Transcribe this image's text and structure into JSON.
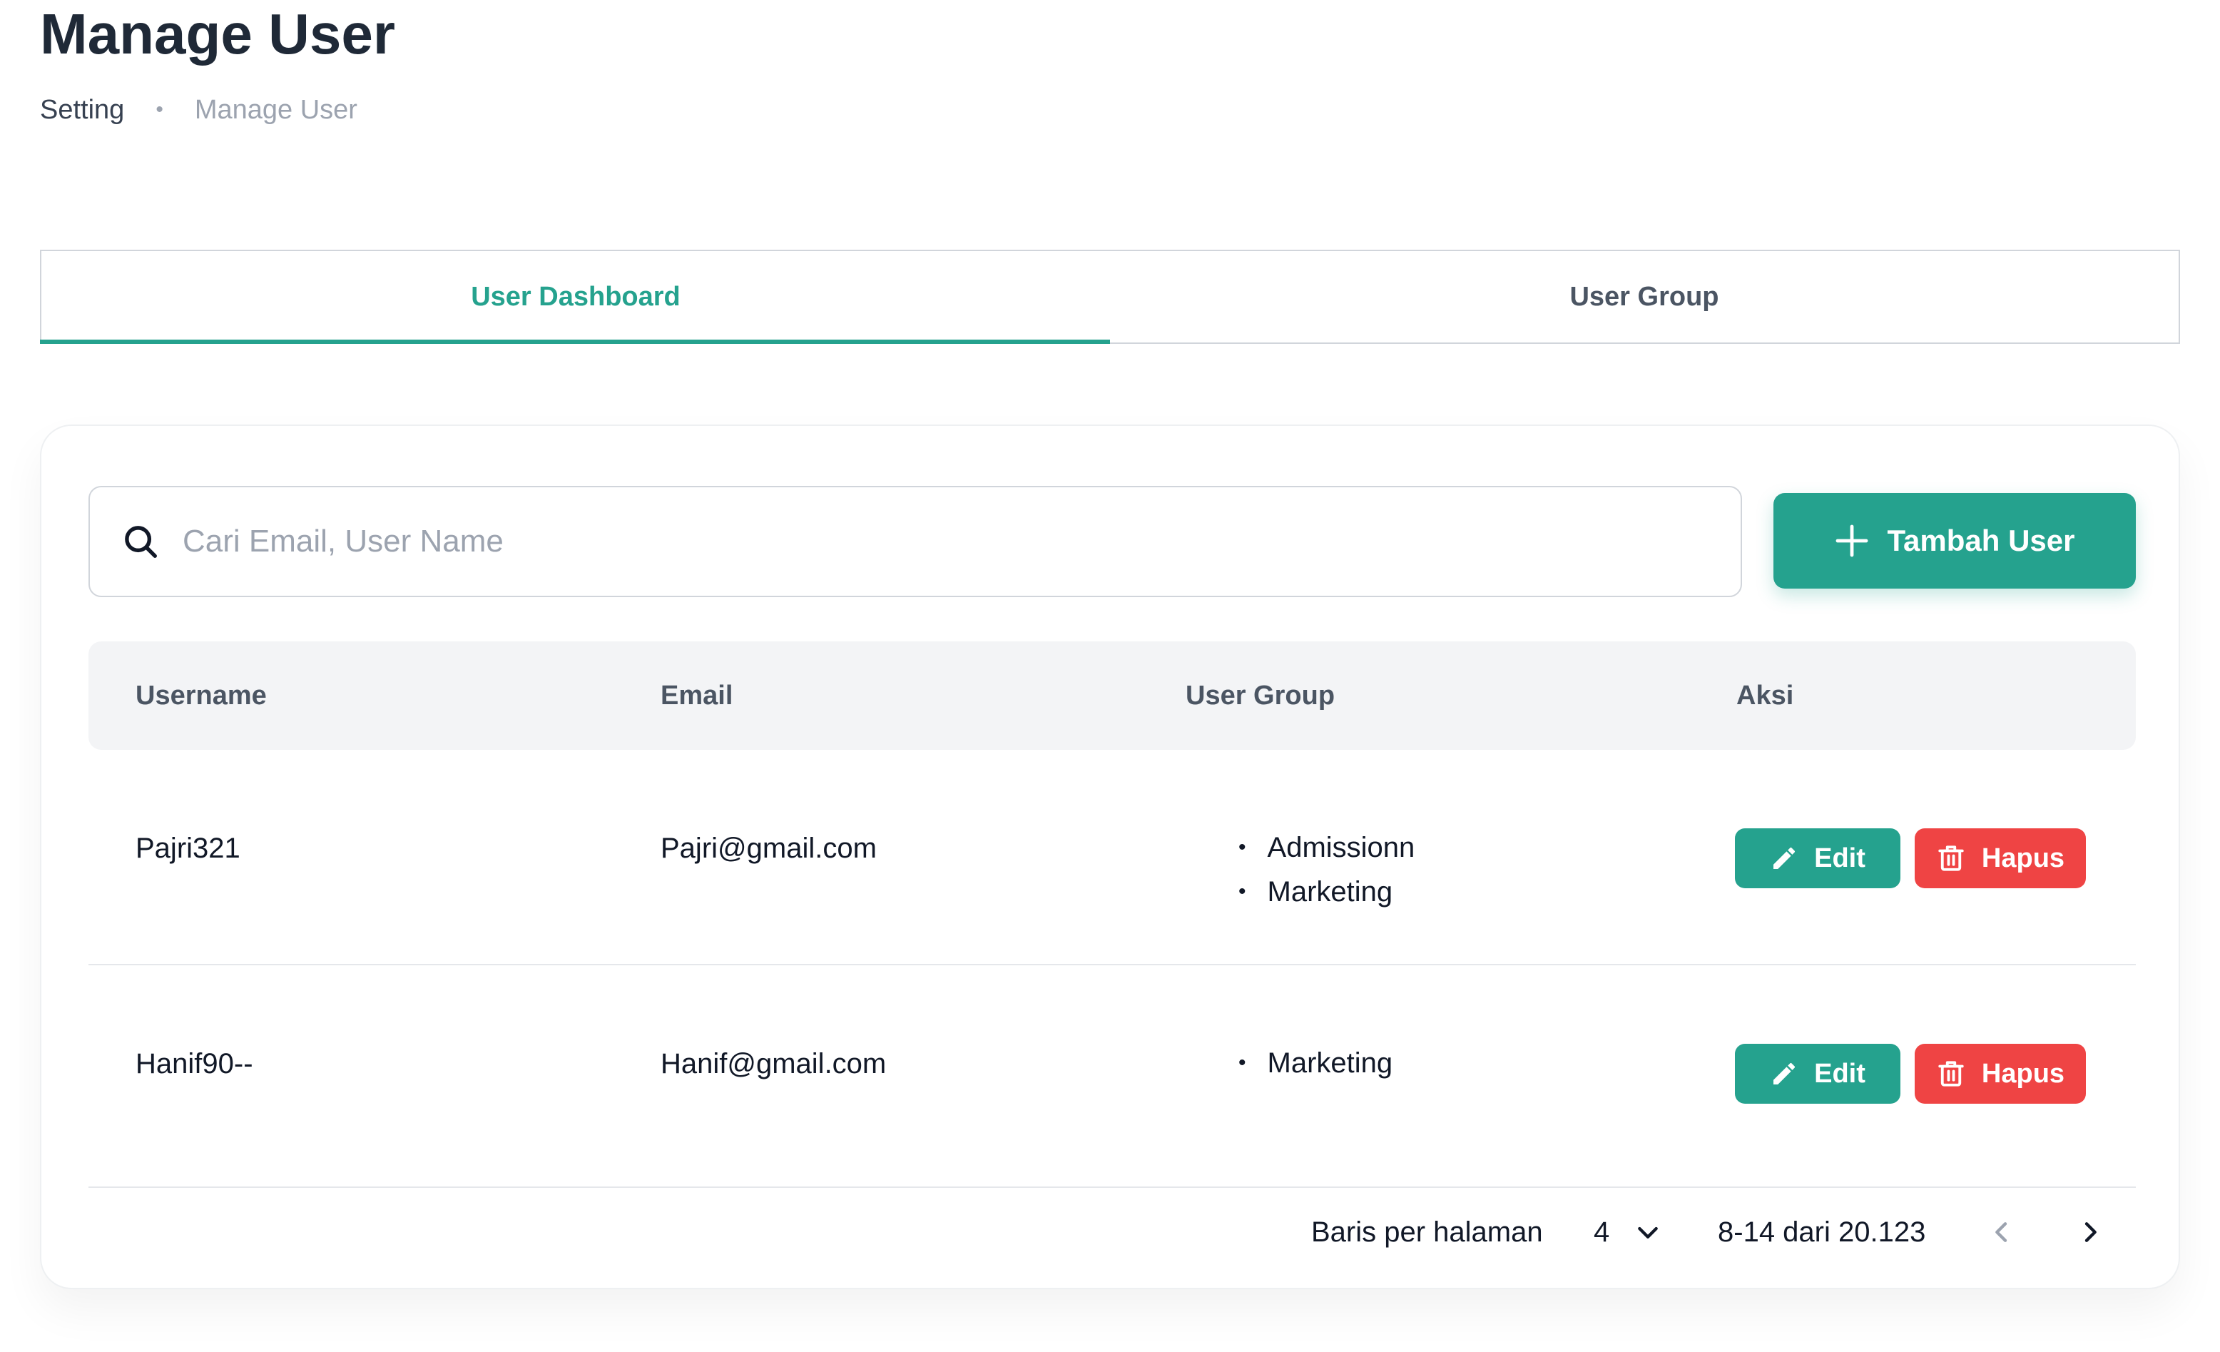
{
  "page": {
    "title": "Manage User",
    "breadcrumb": [
      "Setting",
      "Manage User"
    ],
    "breadcrumb_separator": "•"
  },
  "tabs": [
    {
      "label": "User Dashboard",
      "active": true
    },
    {
      "label": "User Group",
      "active": false
    }
  ],
  "search": {
    "placeholder": "Cari Email, User Name",
    "value": ""
  },
  "add_button": {
    "label": "Tambah User"
  },
  "table": {
    "columns": [
      "Username",
      "Email",
      "User Group",
      "Aksi"
    ],
    "rows": [
      {
        "username": "Pajri321",
        "email": "Pajri@gmail.com",
        "groups": [
          "Admissionn",
          "Marketing"
        ],
        "edit_label": "Edit",
        "delete_label": "Hapus"
      },
      {
        "username": "Hanif90--",
        "email": "Hanif@gmail.com",
        "groups": [
          "Marketing"
        ],
        "edit_label": "Edit",
        "delete_label": "Hapus"
      }
    ]
  },
  "pagination": {
    "rows_per_page_label": "Baris per halaman",
    "rows_per_page": "4",
    "range_label": "8-14 dari 20.123"
  },
  "colors": {
    "accent": "#25a28e",
    "danger": "#ef4444"
  }
}
